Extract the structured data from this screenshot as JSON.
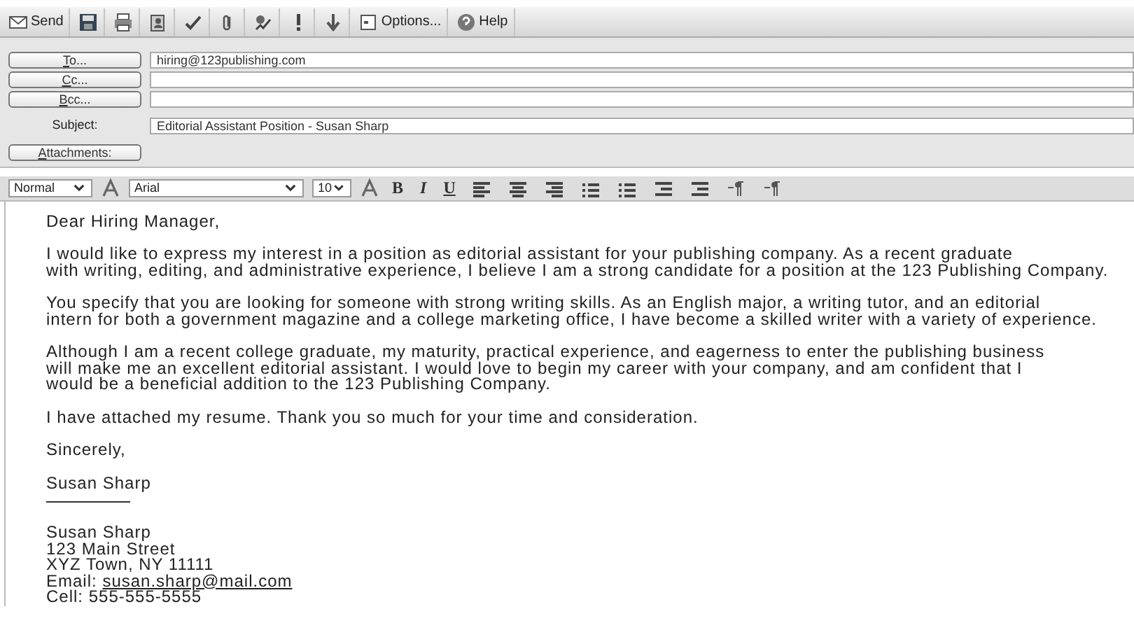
{
  "toolbar": [
    {
      "kind": "text",
      "label": "Send"
    },
    {
      "kind": "icon"
    },
    {
      "kind": "icon"
    },
    {
      "kind": "icon"
    },
    {
      "kind": "icon"
    },
    {
      "kind": "icon"
    },
    {
      "kind": "icon"
    },
    {
      "kind": "icon"
    },
    {
      "kind": "icon"
    },
    {
      "kind": "text",
      "label": "Options..."
    },
    {
      "kind": "text",
      "label": "Help"
    }
  ],
  "address_fields": [
    {
      "button": "To...",
      "value": "hiring@123publishing.com"
    },
    {
      "button": "Cc..."
    },
    {
      "button": "Bcc..."
    }
  ],
  "subject": {
    "label": "Subject:",
    "value": "Editorial Assistant Position - Susan Sharp"
  },
  "attachments_button": "Attachments:",
  "format_bar": {
    "style": "Normal",
    "font": "Arial",
    "size": "10",
    "bold": "B",
    "italic": "I",
    "underline": "U"
  },
  "body": {
    "paragraphs": [
      [
        "Dear Hiring Manager,"
      ],
      [
        "I would like to express my interest in a position as editorial assistant for your publishing company. As a recent graduate",
        "with writing, editing, and administrative experience, I believe I am a strong candidate for a position at the 123 Publishing Company."
      ],
      [
        "You specify that you are looking for someone with strong writing skills. As an English major, a writing tutor, and an editorial",
        "intern for both a government magazine and a college marketing office, I have become a skilled writer with a variety of experience."
      ],
      [
        "Although I am a recent college graduate, my maturity, practical experience, and eagerness to enter the publishing business",
        "will make me an excellent editorial assistant. I would love to begin my career with your company, and am confident that I",
        "would be a beneficial addition to the 123 Publishing Company."
      ],
      [
        "I have attached my resume. Thank you so much for your time and consideration."
      ],
      [
        "Sincerely,"
      ],
      [
        "Susan Sharp"
      ]
    ],
    "signature": {
      "lines": [
        "Susan Sharp",
        "123 Main Street",
        "XYZ Town, NY 11111"
      ],
      "email_label": "Email:",
      "email": "susan.sharp@mail.com",
      "cell": "Cell: 555-555-5555"
    }
  }
}
